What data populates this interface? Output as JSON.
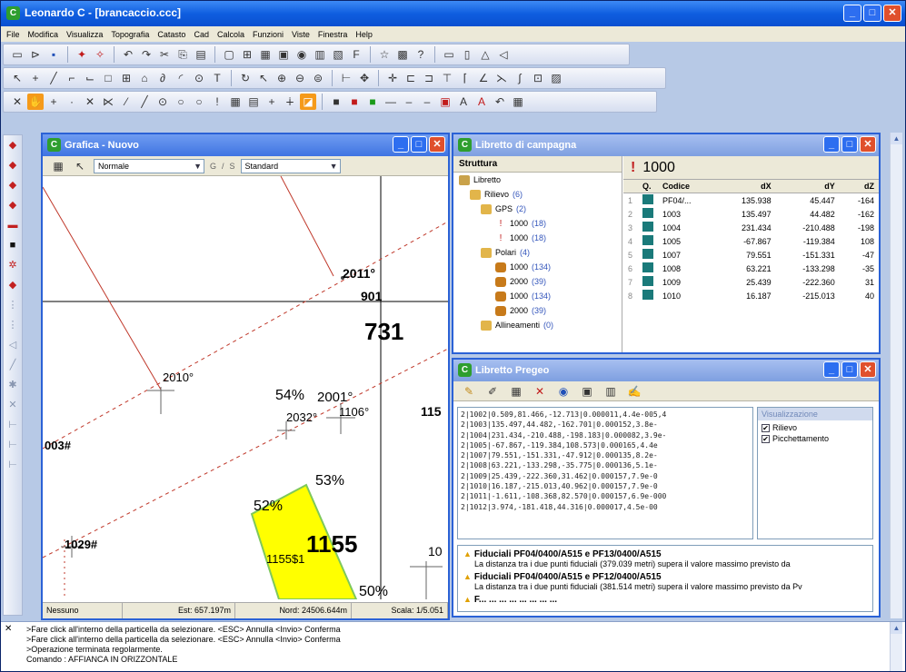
{
  "app": {
    "title": "Leonardo C - [brancaccio.ccc]",
    "icon_letter": "C",
    "min": "_",
    "max": "□",
    "close": "✕"
  },
  "menu": [
    "File",
    "Modifica",
    "Visualizza",
    "Topografia",
    "Catasto",
    "Cad",
    "Calcola",
    "Funzioni",
    "Viste",
    "Finestra",
    "Help"
  ],
  "grafica": {
    "title": "Grafica - Nuovo",
    "mode_select": "Normale",
    "style_select": "Standard",
    "g_label": "G",
    "s_label": "S",
    "canvas_labels": {
      "p2011": "2011°",
      "n901": "901",
      "n731": "731",
      "p2010": "2010°",
      "pct54": "54%",
      "p2001": "2001°",
      "n1106": "1106°",
      "p2032": "2032°",
      "n115": "115",
      "p003": "003#",
      "pct53": "53%",
      "pct52": "52%",
      "n1155": "1155",
      "n1155s1": "1155$1",
      "p1029": "1029#",
      "n10": "10",
      "pct50": "50%"
    },
    "status": {
      "layer": "Nessuno",
      "est": "Est: 657.197m",
      "nord": "Nord: 24506.644m",
      "scala": "Scala: 1/5.051"
    }
  },
  "libretto": {
    "title": "Libretto di campagna",
    "struttura_header": "Struttura",
    "selected_point": "1000",
    "tree": [
      {
        "label": "Libretto",
        "count": "",
        "icon": "book"
      },
      {
        "label": "Rilievo",
        "count": "(6)",
        "icon": "folder"
      },
      {
        "label": "GPS",
        "count": "(2)",
        "icon": "folder"
      },
      {
        "label": "1000",
        "count": "(18)",
        "icon": "red"
      },
      {
        "label": "1000",
        "count": "(18)",
        "icon": "red"
      },
      {
        "label": "Polari",
        "count": "(4)",
        "icon": "folder"
      },
      {
        "label": "1000",
        "count": "(134)",
        "icon": "cyl"
      },
      {
        "label": "2000",
        "count": "(39)",
        "icon": "cyl"
      },
      {
        "label": "1000",
        "count": "(134)",
        "icon": "cyl"
      },
      {
        "label": "2000",
        "count": "(39)",
        "icon": "cyl"
      },
      {
        "label": "Allineamenti",
        "count": "(0)",
        "icon": "folder"
      }
    ],
    "columns": [
      "Q.",
      "Codice",
      "dX",
      "dY",
      "dZ"
    ],
    "rows": [
      {
        "n": "1",
        "codice": "PF04/...",
        "dx": "135.938",
        "dy": "45.447",
        "dz": "-164"
      },
      {
        "n": "2",
        "codice": "1003",
        "dx": "135.497",
        "dy": "44.482",
        "dz": "-162"
      },
      {
        "n": "3",
        "codice": "1004",
        "dx": "231.434",
        "dy": "-210.488",
        "dz": "-198"
      },
      {
        "n": "4",
        "codice": "1005",
        "dx": "-67.867",
        "dy": "-119.384",
        "dz": "108"
      },
      {
        "n": "5",
        "codice": "1007",
        "dx": "79.551",
        "dy": "-151.331",
        "dz": "-47"
      },
      {
        "n": "6",
        "codice": "1008",
        "dx": "63.221",
        "dy": "-133.298",
        "dz": "-35"
      },
      {
        "n": "7",
        "codice": "1009",
        "dx": "25.439",
        "dy": "-222.360",
        "dz": "31"
      },
      {
        "n": "8",
        "codice": "1010",
        "dx": "16.187",
        "dy": "-215.013",
        "dz": "40"
      }
    ]
  },
  "pregeo": {
    "title": "Libretto Pregeo",
    "lines": [
      "2|1002|0.509,81.466,-12.713|0.000011,4.4e-005,4",
      "2|1003|135.497,44.482,-162.701|0.000152,3.8e-",
      "2|1004|231.434,-210.488,-198.183|0.000082,3.9e-",
      "2|1005|-67.867,-119.384,108.573|0.000165,4.4e",
      "2|1007|79.551,-151.331,-47.912|0.000135,8.2e-",
      "2|1008|63.221,-133.298,-35.775|0.000136,5.1e-",
      "2|1009|25.439,-222.360,31.462|0.000157,7.9e-0",
      "2|1010|16.187,-215.013,40.962|0.000157,7.9e-0",
      "2|1011|-1.611,-108.368,82.570|0.000157,6.9e-000",
      "2|1012|3.974,-181.418,44.316|0.000017,4.5e-00"
    ],
    "options_header": "Visualizzazione",
    "options": [
      {
        "label": "Rilievo",
        "checked": "✔"
      },
      {
        "label": "Picchettamento",
        "checked": "✔"
      }
    ],
    "warnings": [
      {
        "title": "Fiduciali PF04/0400/A515 e PF13/0400/A515",
        "text": "La distanza tra i due punti fiduciali (379.039 metri) supera il valore massimo previsto da"
      },
      {
        "title": "Fiduciali PF04/0400/A515 e PF12/0400/A515",
        "text": "La distanza tra i due punti fiduciali (381.514 metri) supera il valore massimo previsto da Pv"
      },
      {
        "title": "F... ... ... ... ... ... ... ...",
        "text": ""
      }
    ]
  },
  "console": {
    "lines": [
      ">Fare click all'interno della particella da selezionare. <ESC> Annulla <Invio> Conferma",
      ">Fare click all'interno della particella da selezionare. <ESC> Annulla <Invio> Conferma",
      ">Operazione terminata regolarmente.",
      "Comando : AFFIANCA IN ORIZZONTALE"
    ]
  },
  "colors": {
    "title_blue": "#0f5ee0",
    "parcel_yellow": "#ffff00",
    "road_red": "#c0392b"
  }
}
